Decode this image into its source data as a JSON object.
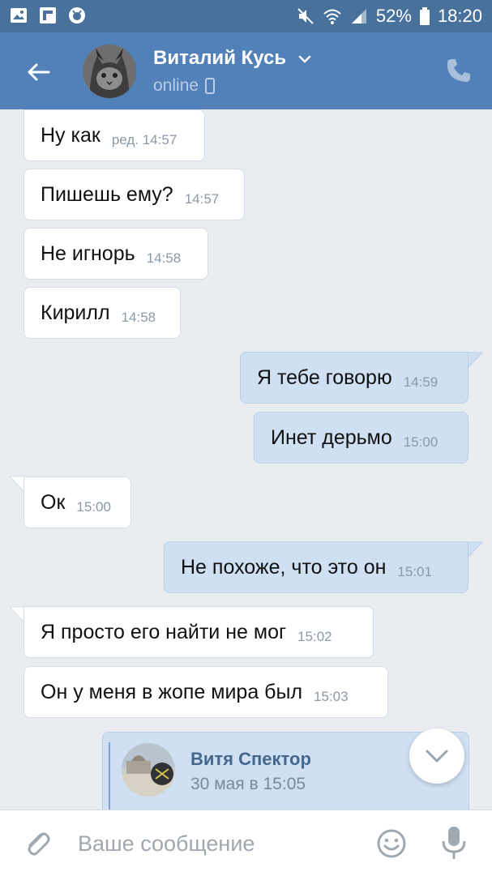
{
  "status_bar": {
    "battery": "52%",
    "time": "18:20",
    "icons": [
      "gallery-icon",
      "flipboard-icon",
      "shield-icon",
      "mute-icon",
      "wifi-icon",
      "signal-icon",
      "battery-icon"
    ]
  },
  "header": {
    "name": "Виталий Кусь",
    "status": "online",
    "accent": "#5181b8"
  },
  "messages": [
    {
      "dir": "in",
      "text": "Ну как",
      "time": "ред. 14:57"
    },
    {
      "dir": "in",
      "text": "Пишешь ему?",
      "time": "14:57"
    },
    {
      "dir": "in",
      "text": "Не игнорь",
      "time": "14:58"
    },
    {
      "dir": "in",
      "text": "Кирилл",
      "time": "14:58"
    },
    {
      "dir": "out",
      "text": "Я тебе говорю",
      "time": "14:59"
    },
    {
      "dir": "out",
      "text": "Инет дерьмо",
      "time": "15:00"
    },
    {
      "dir": "in",
      "text": "Ок",
      "time": "15:00"
    },
    {
      "dir": "out",
      "text": "Не похоже, что это он",
      "time": "15:01"
    },
    {
      "dir": "in",
      "text": "Я просто его найти не мог",
      "time": "15:02"
    },
    {
      "dir": "in",
      "text": "Он у меня в жопе мира был",
      "time": "15:03"
    }
  ],
  "forwarded": {
    "name": "Витя Спектор",
    "date": "30 мая в 15:05"
  },
  "composer": {
    "placeholder": "Ваше сообщение"
  }
}
